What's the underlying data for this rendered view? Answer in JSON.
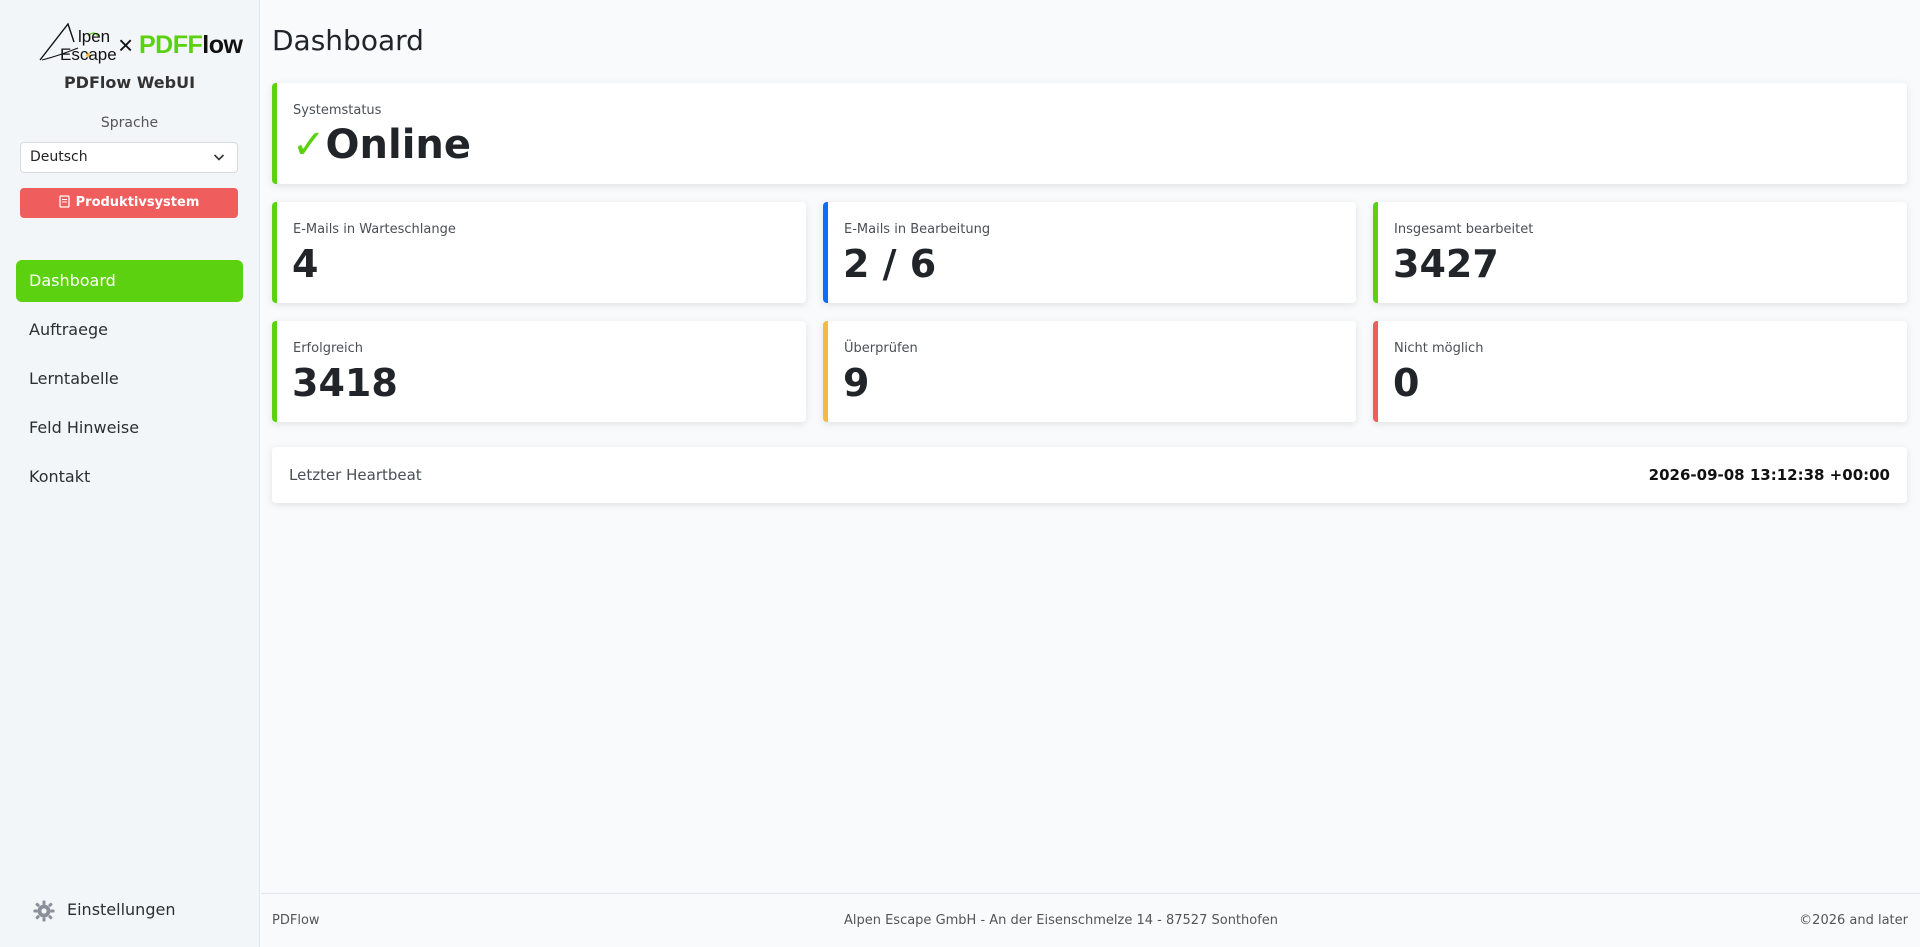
{
  "brand": {
    "logo_alpen_line1": "lpen",
    "logo_alpen_line2": "Escape",
    "logo_times": "×",
    "logo_pdf": "PDF",
    "logo_low": "low",
    "app_title": "PDFlow WebUI"
  },
  "language": {
    "label": "Sprache",
    "selected": "Deutsch"
  },
  "environment_button": "Produktivsystem",
  "nav": {
    "items": [
      {
        "label": "Dashboard"
      },
      {
        "label": "Auftraege"
      },
      {
        "label": "Lerntabelle"
      },
      {
        "label": "Feld Hinweise"
      },
      {
        "label": "Kontakt"
      }
    ],
    "settings_label": "Einstellungen"
  },
  "page": {
    "title": "Dashboard"
  },
  "status": {
    "label": "Systemstatus",
    "check": "✓",
    "value": "Online"
  },
  "stats": [
    {
      "label": "E-Mails in Warteschlange",
      "value": "4"
    },
    {
      "label": "E-Mails in Bearbeitung",
      "value": "2 / 6"
    },
    {
      "label": "Insgesamt bearbeitet",
      "value": "3427"
    },
    {
      "label": "Erfolgreich",
      "value": "3418"
    },
    {
      "label": "Überprüfen",
      "value": "9"
    },
    {
      "label": "Nicht möglich",
      "value": "0"
    }
  ],
  "heartbeat": {
    "label": "Letzter Heartbeat",
    "value": "2026-09-08 13:12:38 +00:00"
  },
  "footer": {
    "left": "PDFlow",
    "center": "Alpen Escape GmbH - An der Eisenschmelze 14 - 87527 Sonthofen",
    "right": "©2026 and later"
  },
  "colors": {
    "accent_green": "#5cd10f",
    "blue": "#0d6efd",
    "yellow": "#f5b945",
    "red": "#f05d5d"
  }
}
